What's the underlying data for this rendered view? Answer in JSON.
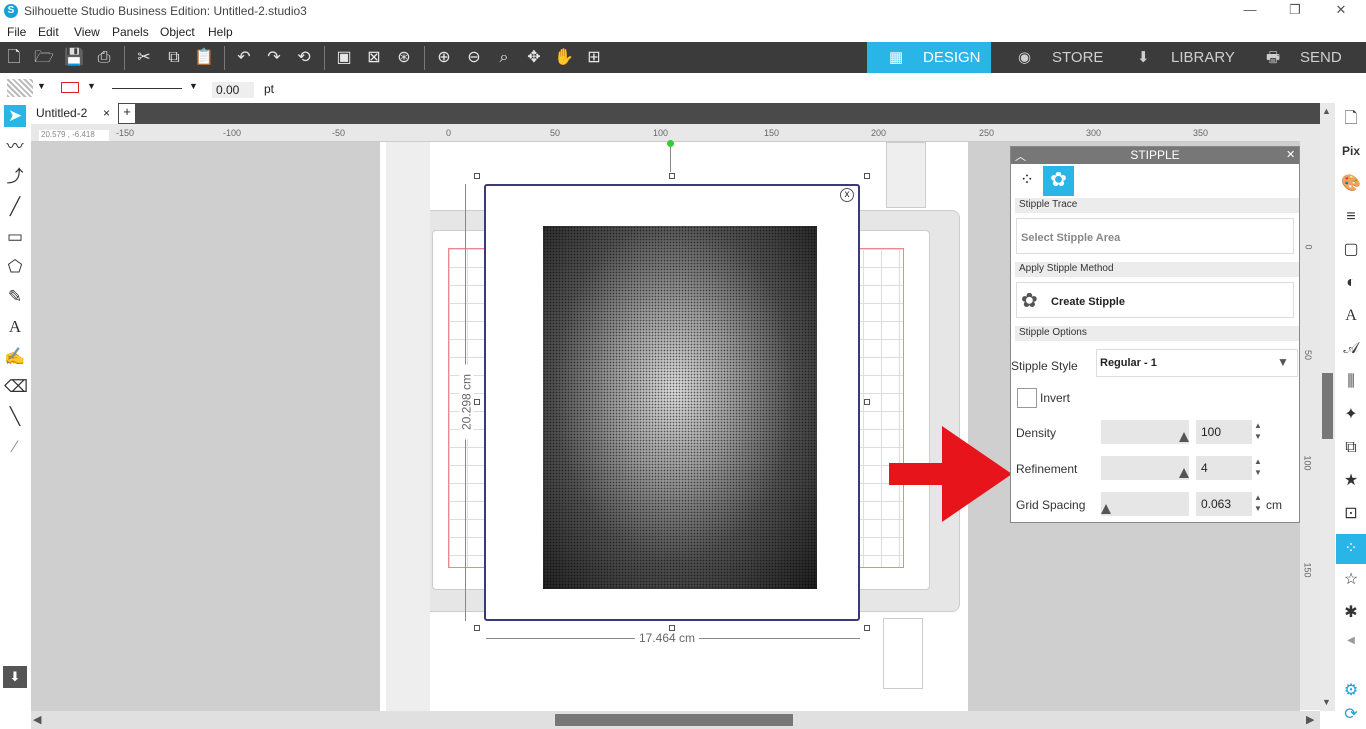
{
  "window": {
    "title": "Silhouette Studio Business Edition: Untitled-2.studio3",
    "minimize": "—",
    "restore": "❐",
    "close": "✕"
  },
  "menu": [
    "File",
    "Edit",
    "View",
    "Panels",
    "Object",
    "Help"
  ],
  "nav_tabs": [
    {
      "label": "DESIGN",
      "icon": "grid-icon",
      "active": true
    },
    {
      "label": "STORE",
      "icon": "store-icon",
      "active": false
    },
    {
      "label": "LIBRARY",
      "icon": "library-icon",
      "active": false
    },
    {
      "label": "SEND",
      "icon": "send-icon",
      "active": false
    }
  ],
  "options": {
    "line_width": "0.00",
    "unit": "pt"
  },
  "doc_tab": {
    "name": "Untitled-2",
    "close": "×",
    "add": "+"
  },
  "rulers": {
    "coords": "20.579 , -6.418",
    "top_ticks": [
      "-150",
      "-100",
      "-50",
      "0",
      "50",
      "100",
      "150",
      "200",
      "250",
      "300",
      "350"
    ],
    "right_ticks": [
      "0",
      "50",
      "100",
      "150"
    ]
  },
  "dimensions": {
    "width": "17.464 cm",
    "height": "20.298 cm",
    "close_x": "x"
  },
  "stipple_panel": {
    "title": "STIPPLE",
    "trace_section": "Stipple Trace",
    "select_area": "Select Stipple Area",
    "method_section": "Apply Stipple Method",
    "create_button": "Create Stipple",
    "options_section": "Stipple Options",
    "style_label": "Stipple Style",
    "style_value": "Regular - 1",
    "invert_label": "Invert",
    "density_label": "Density",
    "density_value": "100",
    "density_level": 1.0,
    "refinement_label": "Refinement",
    "refinement_value": "4",
    "refinement_level": 1.0,
    "grid_label": "Grid Spacing",
    "grid_value": "0.063",
    "grid_level": 0.0,
    "grid_unit": "cm"
  },
  "colors": {
    "accent": "#29b6e6",
    "toolbar": "#3b3b3b",
    "arrow": "#e8141c",
    "selection": "#3a3a7a"
  }
}
